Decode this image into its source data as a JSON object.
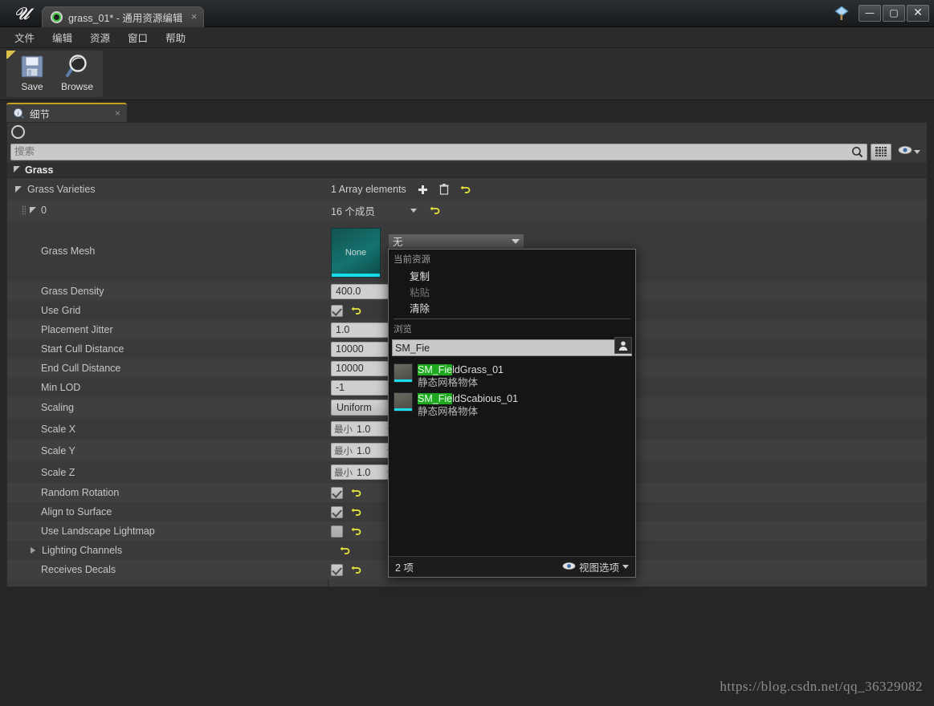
{
  "window": {
    "logo": "ue-logo",
    "tab_title": "grass_01* - 通用资源编辑",
    "tab_close": "×",
    "source_control_icon": "source-control-icon",
    "minimize": "—",
    "maximize": "▢",
    "close": "✕"
  },
  "menubar": {
    "items": [
      {
        "label": "文件"
      },
      {
        "label": "编辑"
      },
      {
        "label": "资源"
      },
      {
        "label": "窗口"
      },
      {
        "label": "帮助"
      }
    ]
  },
  "toolbar": {
    "buttons": [
      {
        "label": "Save",
        "icon": "save-icon"
      },
      {
        "label": "Browse",
        "icon": "browse-icon"
      }
    ]
  },
  "details_panel": {
    "tab_label": "细节",
    "tab_icon": "details-info-icon",
    "tab_close": "×",
    "lock_icon": "lock-circle-icon",
    "search_placeholder": "搜索",
    "search_value": "",
    "search_icon": "search-icon",
    "grid_toggle_icon": "grid-view-icon",
    "visibility_icon": "eye-icon",
    "visibility_chevron": "chevron-down-icon",
    "category": {
      "label": "Grass",
      "expander": "expanded"
    },
    "array_header": {
      "label": "1 Array elements",
      "add_icon": "plus-icon",
      "delete_icon": "trash-icon",
      "reset_icon": "reset-arrow-icon"
    },
    "members_header": {
      "label": "16 个成员",
      "dropdown_icon": "chevron-down-icon",
      "reset_icon": "reset-arrow-icon"
    },
    "tree": [
      {
        "name": "Grass Varieties",
        "indent": 0,
        "expander": "expanded"
      },
      {
        "name": "0",
        "indent": 1,
        "expander": "expanded"
      }
    ],
    "properties": [
      {
        "name": "Grass Mesh",
        "type": "asset",
        "value": "None",
        "thumbnail_label": "None"
      },
      {
        "name": "Grass Density",
        "type": "text",
        "value": "400.0"
      },
      {
        "name": "Use Grid",
        "type": "checkbox",
        "checked": true,
        "reset": true
      },
      {
        "name": "Placement Jitter",
        "type": "text",
        "value": "1.0"
      },
      {
        "name": "Start Cull Distance",
        "type": "text",
        "value": "10000"
      },
      {
        "name": "End Cull Distance",
        "type": "text",
        "value": "10000"
      },
      {
        "name": "Min LOD",
        "type": "text",
        "value": "-1"
      },
      {
        "name": "Scaling",
        "type": "combo",
        "value": "Uniform"
      },
      {
        "name": "Scale X",
        "type": "minmax",
        "prefix": "最小",
        "value": "1.0"
      },
      {
        "name": "Scale Y",
        "type": "minmax",
        "prefix": "最小",
        "value": "1.0"
      },
      {
        "name": "Scale Z",
        "type": "minmax",
        "prefix": "最小",
        "value": "1.0"
      },
      {
        "name": "Random Rotation",
        "type": "checkbox",
        "checked": true,
        "reset": true
      },
      {
        "name": "Align to Surface",
        "type": "checkbox",
        "checked": true,
        "reset": true
      },
      {
        "name": "Use Landscape Lightmap",
        "type": "checkbox",
        "checked": false,
        "reset": true
      },
      {
        "name": "Lighting Channels",
        "type": "resetonly",
        "expander": "collapsed",
        "reset": true
      },
      {
        "name": "Receives Decals",
        "type": "checkbox",
        "checked": true,
        "reset": true
      }
    ]
  },
  "asset_picker": {
    "combo_value": "无",
    "combo_chevron": "chevron-down-icon",
    "section_current": "当前资源",
    "menu_items": [
      {
        "label": "复制",
        "disabled": false
      },
      {
        "label": "粘贴",
        "disabled": true
      },
      {
        "label": "清除",
        "disabled": false
      }
    ],
    "section_browse": "浏览",
    "search_value": "SM_Fie",
    "clear_icon": "x-clear-icon",
    "filter_icon": "person-filter-icon",
    "results": [
      {
        "match": "SM_Fie",
        "rest": "ldGrass_01",
        "subtitle": "静态网格物体",
        "thumb": "static-mesh-thumbnail"
      },
      {
        "match": "SM_Fie",
        "rest": "ldScabious_01",
        "subtitle": "静态网格物体",
        "thumb": "static-mesh-thumbnail"
      }
    ],
    "footer": {
      "count": "2 项",
      "view_options": "视图选项",
      "eye_icon": "eye-icon",
      "chevron": "chevron-down-icon"
    }
  },
  "watermark": "https://blog.csdn.net/qq_36329082",
  "colors": {
    "accent_yellow": "#e8e83c",
    "tab_accent": "#c8a020",
    "thumb_teal": "#147370",
    "thumb_underline": "#19dced",
    "match_highlight": "#1fa81f"
  }
}
